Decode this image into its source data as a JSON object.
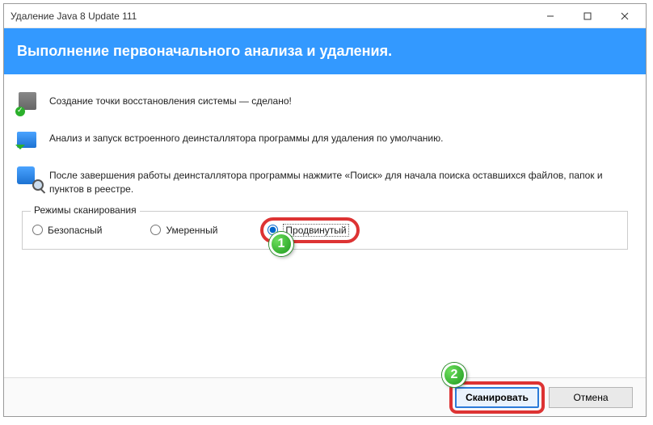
{
  "window": {
    "title": "Удаление Java 8 Update 111"
  },
  "banner": {
    "heading": "Выполнение первоначального анализа и удаления."
  },
  "steps": {
    "restore_point": "Создание точки восстановления системы — сделано!",
    "analyze": "Анализ и запуск встроенного деинсталлятора программы для удаления по умолчанию.",
    "search_remains": "После завершения работы деинсталлятора программы нажмите «Поиск» для начала поиска оставшихся файлов, папок и пунктов в реестре."
  },
  "scan_modes": {
    "legend": "Режимы сканирования",
    "safe": "Безопасный",
    "moderate": "Умеренный",
    "advanced": "Продвинутый"
  },
  "buttons": {
    "scan": "Сканировать",
    "cancel": "Отмена"
  },
  "annotations": {
    "badge1": "1",
    "badge2": "2"
  }
}
